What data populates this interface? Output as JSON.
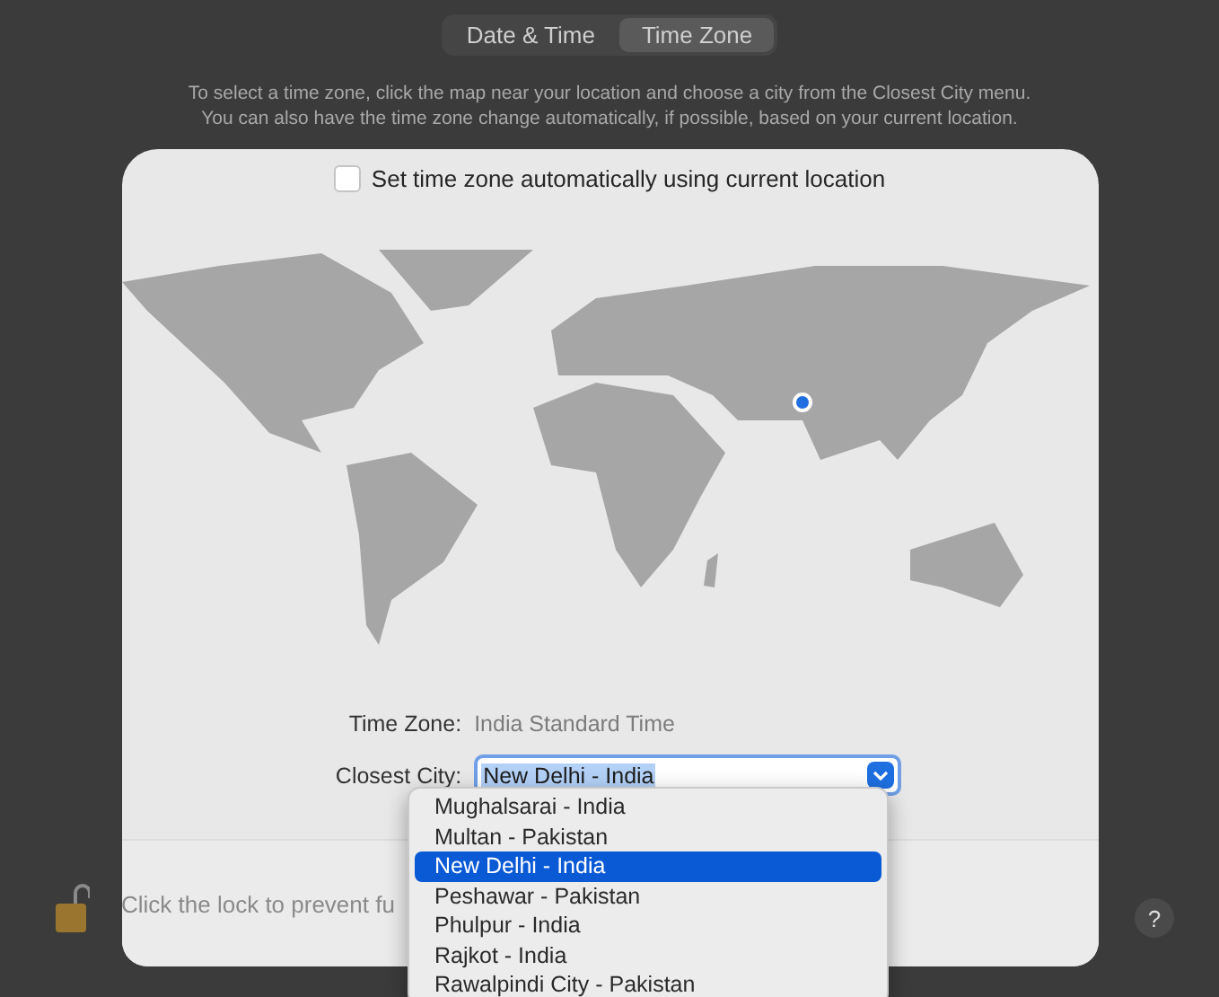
{
  "tabs": [
    {
      "label": "Date & Time",
      "selected": false
    },
    {
      "label": "Time Zone",
      "selected": true
    }
  ],
  "description": [
    "To select a time zone, click the map near your location and choose a city from the Closest City menu.",
    "You can also have the time zone change automatically, if possible, based on your current location."
  ],
  "auto_timezone": {
    "label": "Set time zone automatically using current location",
    "checked": false
  },
  "time_zone": {
    "label": "Time Zone:",
    "value": "India Standard Time"
  },
  "closest_city": {
    "label": "Closest City:",
    "value": "New Delhi - India"
  },
  "city_menu": [
    {
      "label": "Mughalsarai - India",
      "selected": false
    },
    {
      "label": "Multan - Pakistan",
      "selected": false
    },
    {
      "label": "New Delhi - India",
      "selected": true
    },
    {
      "label": "Peshawar - Pakistan",
      "selected": false
    },
    {
      "label": "Phulpur - India",
      "selected": false
    },
    {
      "label": "Rajkot - India",
      "selected": false
    },
    {
      "label": "Rawalpindi City - Pakistan",
      "selected": false
    }
  ],
  "footer": {
    "lock_text": "Click the lock to prevent fu",
    "help": "?"
  }
}
